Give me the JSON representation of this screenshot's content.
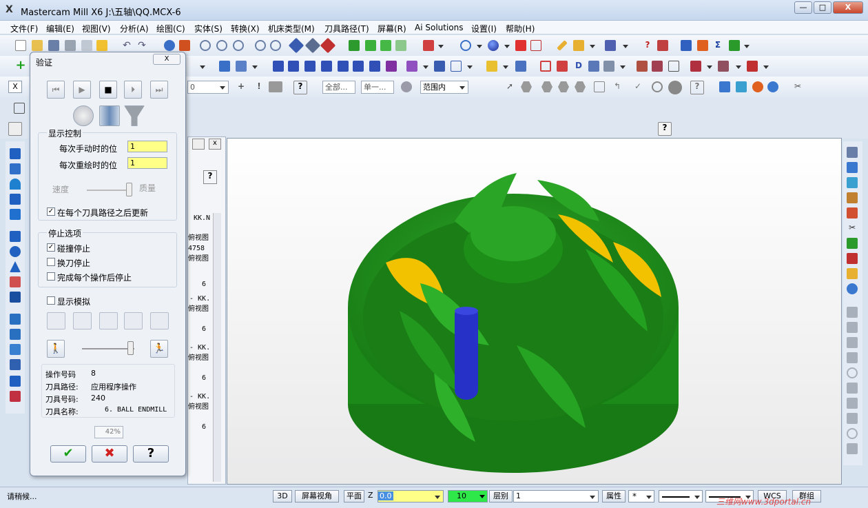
{
  "app": {
    "title": "Mastercam Mill X6  J:\\五轴\\QQ.MCX-6",
    "logo": "X"
  },
  "window_buttons": {
    "minimize": "—",
    "maximize": "□",
    "close": "X"
  },
  "menu": [
    "文件(F)",
    "编辑(E)",
    "视图(V)",
    "分析(A)",
    "绘图(C)",
    "实体(S)",
    "转换(X)",
    "机床类型(M)",
    "刀具路径(T)",
    "屏幕(R)",
    "Ai Solutions",
    "设置(I)",
    "帮助(H)"
  ],
  "toolbar3": {
    "x_label": "X",
    "combo_zero": "0",
    "combo_all": "全部...",
    "combo_single": "单一...",
    "combo_range": "范围内"
  },
  "dialog": {
    "title": "验证",
    "close": "X",
    "display_group": "显示控制",
    "manual_step_label": "每次手动时的位",
    "manual_step_value": "1",
    "redraw_step_label": "每次重绘时的位",
    "redraw_step_value": "1",
    "speed_label": "速度",
    "quality_label": "质量",
    "update_after_path": "在每个刀具路径之后更新",
    "stop_group": "停止选项",
    "stop_on_collision": "碰撞停止",
    "stop_on_toolchange": "换刀停止",
    "stop_after_op": "完成每个操作后停止",
    "show_simulation": "显示模拟",
    "op_number_label": "操作号码",
    "op_number_value": "8",
    "toolpath_label": "刀具路径:",
    "toolpath_value": "应用程序操作",
    "tool_number_label": "刀具号码:",
    "tool_number_value": "240",
    "tool_name_label": "刀具名称:",
    "tool_name_value": "6. BALL ENDMILL",
    "progress": "42%",
    "ok": "✔",
    "cancel": "✖",
    "help": "?"
  },
  "ops_panel": {
    "lines": [
      "KK.N",
      "俯视图",
      "4758",
      "俯视图",
      "6",
      "- KK.",
      "俯视图",
      "6",
      "- KK.",
      "俯视图",
      "6",
      "- KK.",
      "俯视图",
      "6"
    ]
  },
  "status": {
    "message": "请稍候...",
    "btn_3d": "3D",
    "btn_view": "屏幕视角",
    "btn_plane": "平面",
    "z_label": "Z",
    "z_value": "0.0",
    "color_value": "10",
    "level_label": "层别",
    "level_value": "1",
    "attr_label": "属性",
    "point_style": "*",
    "wcs_label": "WCS",
    "group_label": "群组",
    "watermark": "三维网www.3dportal.cn"
  },
  "colors": {
    "part_green": "#1f8a1c",
    "stock_yellow": "#f2c200",
    "tool_blue": "#2631c8",
    "highlight_yellow": "#ffff88",
    "status_green": "#2ee84a"
  }
}
